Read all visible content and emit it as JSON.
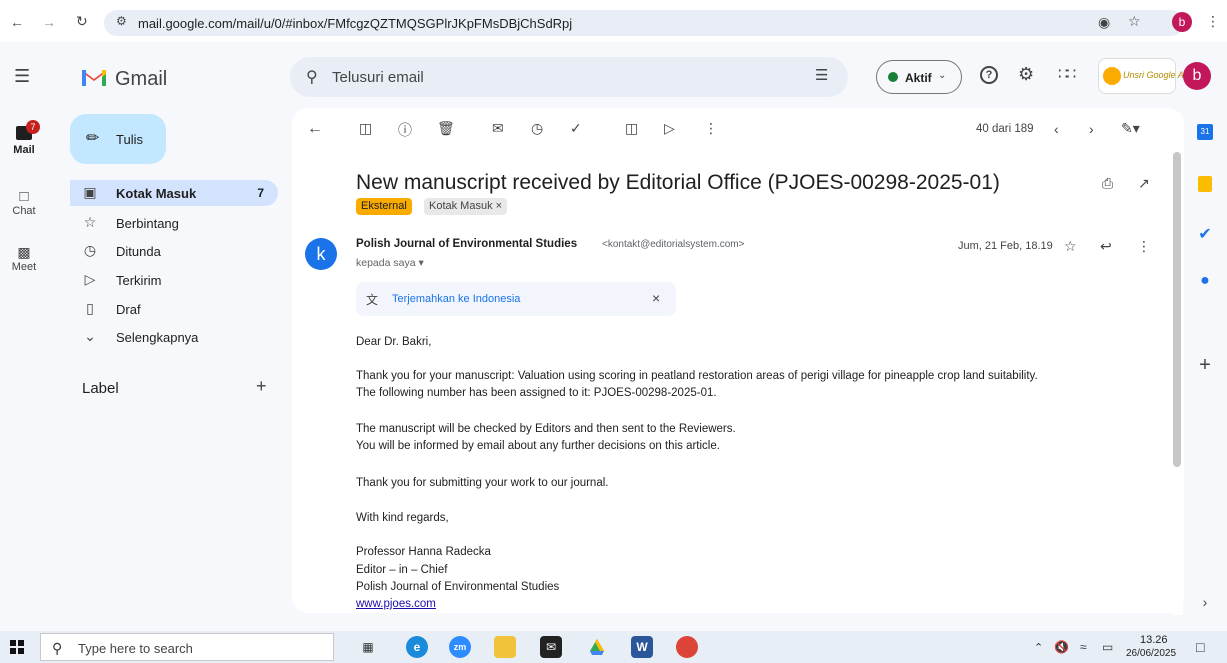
{
  "browser": {
    "url": "mail.google.com/mail/u/0/#inbox/FMfcgzQZTMQSGPlrJKpFMsDBjChSdRpj",
    "profile_letter": "b"
  },
  "gmail": {
    "app_name": "Gmail",
    "search_placeholder": "Telusuri email",
    "status_label": "Aktif",
    "profile_letter": "b",
    "brand_badge": "Unsri Google Apps"
  },
  "rail": {
    "mail_label": "Mail",
    "mail_badge": "7",
    "chat_label": "Chat",
    "meet_label": "Meet"
  },
  "sidebar": {
    "compose_label": "Tulis",
    "items": [
      {
        "label": "Kotak Masuk",
        "count": "7"
      },
      {
        "label": "Berbintang",
        "count": ""
      },
      {
        "label": "Ditunda",
        "count": ""
      },
      {
        "label": "Terkirim",
        "count": ""
      },
      {
        "label": "Draf",
        "count": ""
      },
      {
        "label": "Selengkapnya",
        "count": ""
      }
    ],
    "label_heading": "Label"
  },
  "toolbar": {
    "pagination": "40 dari 189"
  },
  "email": {
    "subject": "New manuscript received by Editorial Office (PJOES-00298-2025-01)",
    "chip_external": "Eksternal",
    "chip_inbox": "Kotak Masuk",
    "avatar_letter": "k",
    "sender_name": "Polish Journal of Environmental Studies",
    "sender_email": "<kontakt@editorialsystem.com>",
    "recipient": "kepada saya",
    "date": "Jum, 21 Feb, 18.19",
    "translate_label": "Terjemahkan ke Indonesia",
    "body": {
      "greeting": "Dear Dr. Bakri,",
      "p1_line1": "Thank you for your manuscript: Valuation using scoring in peatland restoration areas of perigi village for pineapple crop land suitability.",
      "p1_line2": "The following number has been assigned to it: PJOES-00298-2025-01.",
      "p2_line1": "The manuscript will be checked by Editors and then sent to the Reviewers.",
      "p2_line2": "You will be informed by email about any further decisions on this article.",
      "p3": "Thank you for submitting your work to our journal.",
      "closing": "With kind regards,",
      "sig_name": "Professor Hanna Radecka",
      "sig_title": "Editor – in – Chief",
      "sig_org": "Polish Journal of Environmental Studies",
      "sig_link": "www.pjoes.com"
    }
  },
  "taskbar": {
    "search_placeholder": "Type here to search",
    "time": "13.26",
    "date": "26/06/2025"
  },
  "colors": {
    "accent_blue": "#1a73e8",
    "compose_bg": "#c2e7ff",
    "active_nav": "#d3e3fd",
    "chip_external": "#f9ab00",
    "profile": "#c2185b",
    "status_green": "#188038"
  }
}
